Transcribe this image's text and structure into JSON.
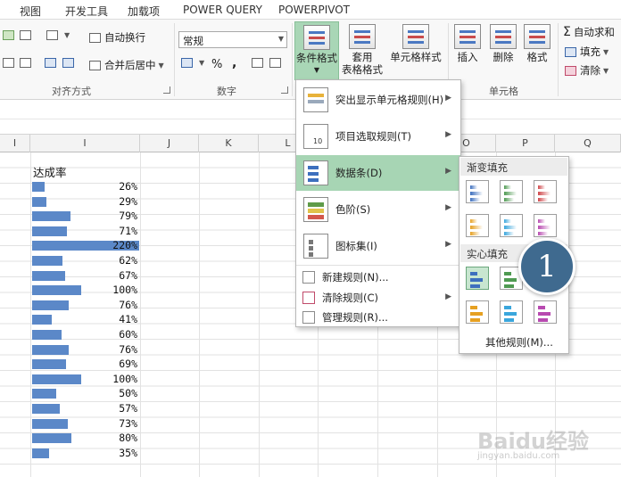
{
  "tabs": [
    "视图",
    "开发工具",
    "加载项",
    "POWER QUERY",
    "POWERPIVOT"
  ],
  "alignment": {
    "wrap_text": "自动换行",
    "merge_center": "合并后居中",
    "group_label": "对齐方式"
  },
  "number": {
    "format": "常规",
    "percent": "%",
    "comma": ",",
    "group_label": "数字"
  },
  "styles": {
    "conditional_formatting": "条件格式",
    "table_format_1": "套用",
    "table_format_2": "表格格式",
    "cell_styles": "单元格样式"
  },
  "cells": {
    "insert": "插入",
    "delete": "删除",
    "format": "格式",
    "group_label": "单元格"
  },
  "editing": {
    "autosum": "自动求和",
    "fill": "填充",
    "clear": "清除"
  },
  "columns": [
    "I",
    "I",
    "J",
    "K",
    "L",
    "O",
    "P",
    "Q"
  ],
  "sheet": {
    "header": "达成率",
    "rows": [
      {
        "label": "26%",
        "value": 26
      },
      {
        "label": "29%",
        "value": 29
      },
      {
        "label": "79%",
        "value": 79
      },
      {
        "label": "71%",
        "value": 71
      },
      {
        "label": "220%",
        "value": 220
      },
      {
        "label": "62%",
        "value": 62
      },
      {
        "label": "67%",
        "value": 67
      },
      {
        "label": "100%",
        "value": 100
      },
      {
        "label": "76%",
        "value": 76
      },
      {
        "label": "41%",
        "value": 41
      },
      {
        "label": "60%",
        "value": 60
      },
      {
        "label": "76%",
        "value": 76
      },
      {
        "label": "69%",
        "value": 69
      },
      {
        "label": "100%",
        "value": 100
      },
      {
        "label": "50%",
        "value": 50
      },
      {
        "label": "57%",
        "value": 57
      },
      {
        "label": "73%",
        "value": 73
      },
      {
        "label": "80%",
        "value": 80
      },
      {
        "label": "35%",
        "value": 35
      }
    ]
  },
  "cf_menu": {
    "highlight_rules": "突出显示单元格规则(H)",
    "top_bottom_rules": "项目选取规则(T)",
    "data_bars": "数据条(D)",
    "color_scales": "色阶(S)",
    "icon_sets": "图标集(I)",
    "new_rule": "新建规则(N)...",
    "clear_rules": "清除规则(C)",
    "manage_rules": "管理规则(R)..."
  },
  "data_bar_menu": {
    "gradient_fill": "渐变填充",
    "solid_fill": "实心填充",
    "more_rules": "其他规则(M)...",
    "colors": [
      "#3d6fbe",
      "#4f9a52",
      "#d0464a",
      "#e6a021",
      "#3aa6dc",
      "#b84ab0"
    ]
  },
  "callout": "1",
  "watermark": "Baidu经验",
  "watermark_sub": "jingyan.baidu.com"
}
